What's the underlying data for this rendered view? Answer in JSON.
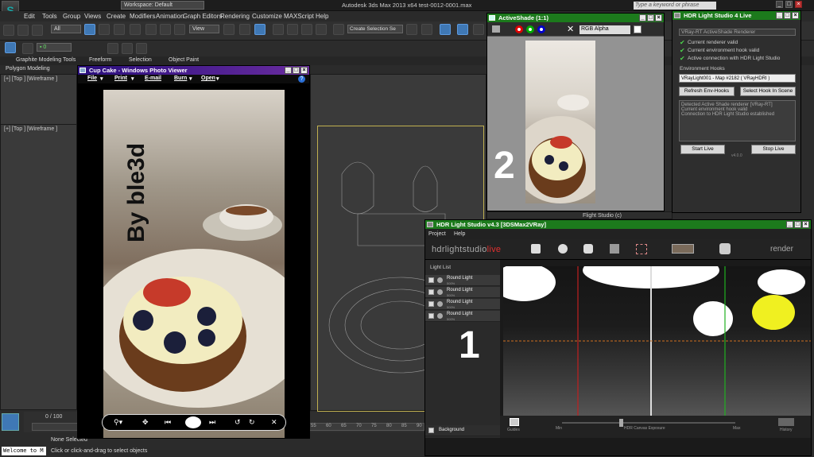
{
  "max": {
    "title": "Autodesk 3ds Max  2013 x64     test-0012-0001.max",
    "workspace": "Workspace: Default",
    "search_placeholder": "Type a keyword or phrase",
    "menus": [
      "Edit",
      "Tools",
      "Group",
      "Views",
      "Create",
      "Modifiers",
      "Animation",
      "Graph Editors",
      "Rendering",
      "Customize",
      "MAXScript",
      "Help"
    ],
    "filter": "All",
    "view_dropdown": "View",
    "selection_set": "Create Selection Se",
    "ribbon_tabs": [
      "Graphite Modeling Tools",
      "Freeform",
      "Selection",
      "Object Paint"
    ],
    "polygon_modeling": "Polygon Modeling",
    "vp1_label": "[+] [Top ] [Wireframe ]",
    "vp2_label": "[+] [Top ] [Wireframe ]",
    "timeline": "0 / 100",
    "timeline_ticks": [
      "55",
      "60",
      "65",
      "70",
      "75",
      "80",
      "85",
      "90",
      "95"
    ],
    "welcome": "Welcome to M",
    "none_selected": "None Selected",
    "status_hint": "Click or click-and-drag to select objects",
    "flight_studio": "Flight Studio (c)"
  },
  "photo_viewer": {
    "title": "Cup Cake - Windows Photo Viewer",
    "menus": [
      "File",
      "Print",
      "E-mail",
      "Burn",
      "Open"
    ],
    "watermark": "By ble3d"
  },
  "activeshade": {
    "title": "ActiveShade (1:1)",
    "channel": "RGB Alpha",
    "number": "2"
  },
  "hls_live": {
    "title": "HDR Light Studio 4 Live",
    "renderer": "VRay-RT ActiveShade Renderer",
    "checks": [
      "Current renderer valid",
      "Current environment hook valid",
      "Active connection with HDR Light Studio"
    ],
    "env_hooks_label": "Environment Hooks",
    "hook_value": "VRayLight001 - Map #2182  ( VRayHDRI )",
    "refresh": "Refresh Env-Hooks",
    "select_hook": "Select Hook In Scene",
    "log": [
      "Detected Active Shade renderer [VRay-RT]",
      "Current environment hook valid",
      "Connection to HDR Light Studio established"
    ],
    "start": "Start Live",
    "stop": "Stop Live",
    "ver": "v4.0.0"
  },
  "hls": {
    "title": "HDR Light Studio v4.3 [3DSMax2VRay]",
    "menus": [
      "Project",
      "Help"
    ],
    "brand": "hdrlightstudio",
    "brand_live": "live",
    "render": "render",
    "light_list": "Light List",
    "lights": [
      "Round Light",
      "Round Light",
      "Round Light",
      "Round Light"
    ],
    "light_sub": "500%",
    "background": "Background",
    "number": "1",
    "bottom": [
      "Guides",
      "Min",
      "HDR Canvas Exposure",
      "Max",
      "History"
    ]
  },
  "colors": {
    "accent": "#3f78b5",
    "green_title": "#1c7a1c",
    "pv_title": "#2a0f7d"
  }
}
